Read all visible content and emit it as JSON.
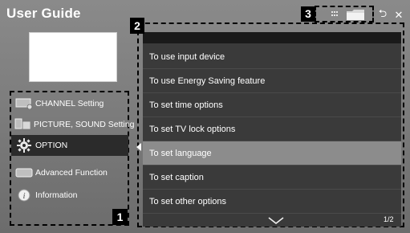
{
  "app": {
    "title": "User Guide"
  },
  "callouts": {
    "menu": "1",
    "list": "2",
    "toolbar": "3"
  },
  "toolbar": {
    "grid_icon": "grid-icon",
    "folder_icon": "folder-icon",
    "back_glyph": "⮌",
    "close_glyph": "✕"
  },
  "sidebar": {
    "items": [
      {
        "label": "CHANNEL Setting",
        "icon": "channel-icon"
      },
      {
        "label": "PICTURE, SOUND Setting",
        "icon": "picture-sound-icon"
      },
      {
        "label": "OPTION",
        "icon": "gear-icon",
        "selected": true
      },
      {
        "label": "Advanced Function",
        "icon": "advanced-function-icon"
      },
      {
        "label": "Information",
        "icon": "info-icon"
      }
    ]
  },
  "list": {
    "items": [
      {
        "label": "To use input device"
      },
      {
        "label": "To use Energy Saving feature"
      },
      {
        "label": "To set time options"
      },
      {
        "label": "To set TV lock options"
      },
      {
        "label": "To set language",
        "selected": true
      },
      {
        "label": "To set caption"
      },
      {
        "label": "To set other options"
      }
    ],
    "page": "1/2"
  },
  "colors": {
    "selected_row": "#8c8c8c",
    "panel": "#3a3a3a",
    "menu_selected": "#2b2b2b"
  }
}
